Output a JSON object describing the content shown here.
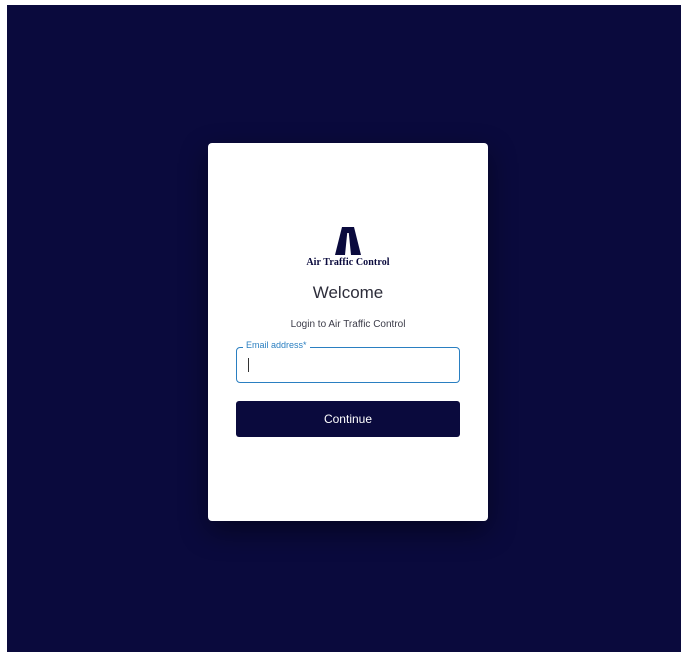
{
  "brand": {
    "logo_icon": "air-traffic-control-logo-icon",
    "name": "Air Traffic Control"
  },
  "login": {
    "title": "Welcome",
    "subtitle": "Login to Air Traffic Control",
    "email_label": "Email address*",
    "email_value": "",
    "continue_label": "Continue"
  },
  "colors": {
    "background": "#0a0a3d",
    "card": "#ffffff",
    "accent": "#2a7fc1",
    "button": "#0a0a3d"
  }
}
